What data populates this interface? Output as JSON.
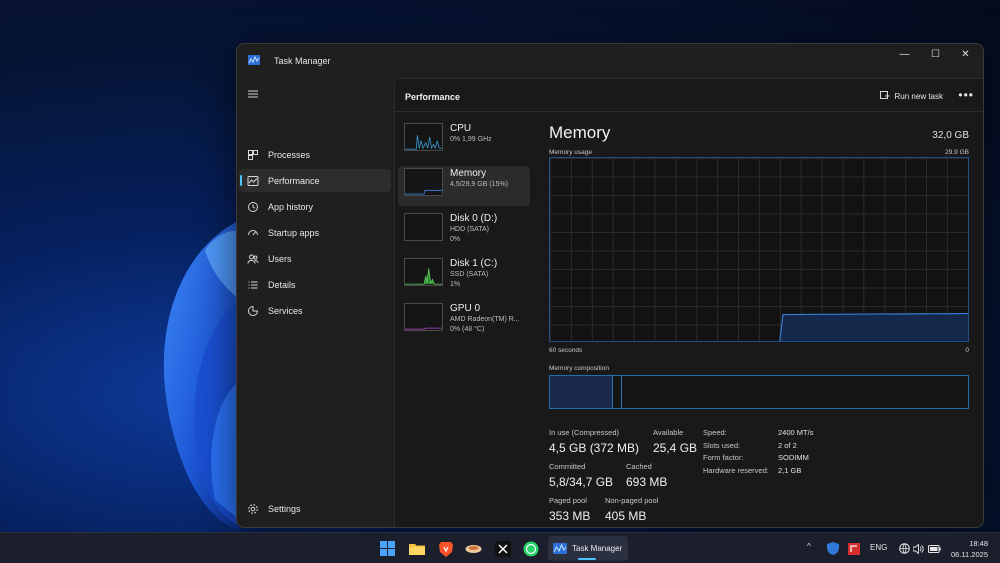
{
  "window": {
    "title": "Task Manager"
  },
  "window_controls": {
    "minimize": "—",
    "maximize": "☐",
    "close": "✕"
  },
  "sidebar": {
    "items": [
      {
        "label": "Processes",
        "icon": "processes-icon"
      },
      {
        "label": "Performance",
        "icon": "performance-icon",
        "active": true
      },
      {
        "label": "App history",
        "icon": "history-icon"
      },
      {
        "label": "Startup apps",
        "icon": "startup-icon"
      },
      {
        "label": "Users",
        "icon": "users-icon"
      },
      {
        "label": "Details",
        "icon": "details-icon"
      },
      {
        "label": "Services",
        "icon": "services-icon"
      }
    ],
    "settings_label": "Settings"
  },
  "header": {
    "title": "Performance",
    "run_task_label": "Run new task",
    "more": "•••"
  },
  "resources": [
    {
      "name": "CPU",
      "sub": "0%  1,99 GHz",
      "sub2": ""
    },
    {
      "name": "Memory",
      "sub": "4,5/29,9 GB (15%)",
      "sub2": ""
    },
    {
      "name": "Disk 0 (D:)",
      "sub": "HDD (SATA)",
      "sub2": "0%"
    },
    {
      "name": "Disk 1 (C:)",
      "sub": "SSD (SATA)",
      "sub2": "1%"
    },
    {
      "name": "GPU 0",
      "sub": "AMD Radeon(TM) R...",
      "sub2": "0%  (48 °C)"
    }
  ],
  "memory": {
    "title": "Memory",
    "total": "32,0 GB",
    "usage_label": "Memory usage",
    "usage_max": "29,9 GB",
    "time_left": "60 seconds",
    "time_right": "0",
    "composition_label": "Memory composition",
    "usage_fraction": 0.15,
    "stats": {
      "in_use_label": "In use (Compressed)",
      "in_use_value": "4,5 GB (372 MB)",
      "available_label": "Available",
      "available_value": "25,4 GB",
      "committed_label": "Committed",
      "committed_value": "5,8/34,7 GB",
      "cached_label": "Cached",
      "cached_value": "693 MB",
      "paged_label": "Paged pool",
      "paged_value": "353 MB",
      "nonpaged_label": "Non-paged pool",
      "nonpaged_value": "405 MB"
    },
    "specs": [
      {
        "k": "Speed:",
        "v": "2400 MT/s"
      },
      {
        "k": "Slots used:",
        "v": "2 of 2"
      },
      {
        "k": "Form factor:",
        "v": "SODIMM"
      },
      {
        "k": "Hardware reserved:",
        "v": "2,1 GB"
      }
    ]
  },
  "taskbar": {
    "active_app_label": "Task Manager",
    "tray": {
      "chevron": "^",
      "language": "ENG"
    },
    "clock": {
      "time": "18:48",
      "date": "06.11.2025"
    }
  },
  "colors": {
    "accent": "#4cc2ff",
    "memory_line": "#3a7bd5"
  }
}
